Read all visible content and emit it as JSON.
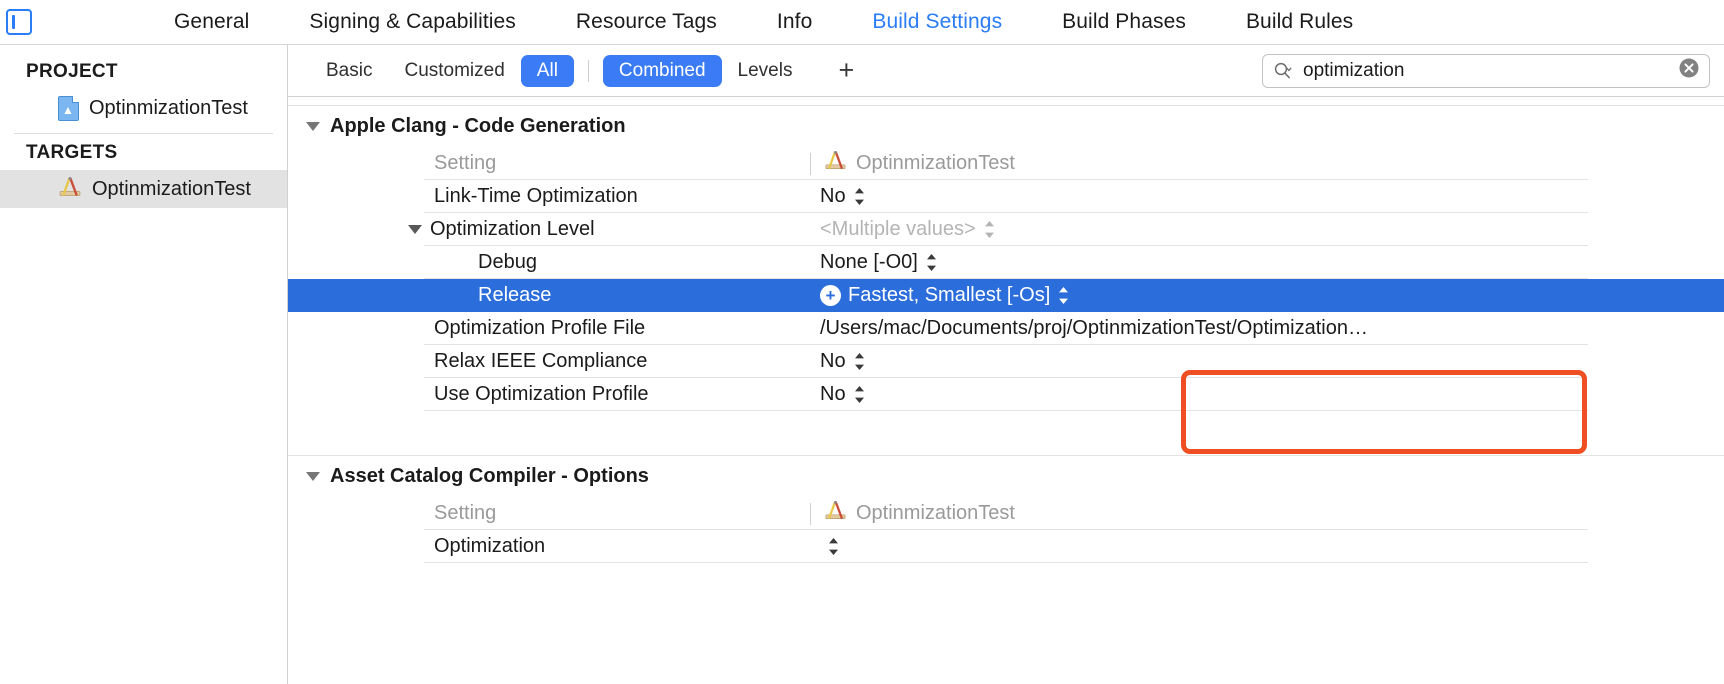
{
  "window": {
    "editor_toggle_icon": "editor-panel-icon"
  },
  "tabs": [
    {
      "label": "General",
      "active": false
    },
    {
      "label": "Signing & Capabilities",
      "active": false
    },
    {
      "label": "Resource Tags",
      "active": false
    },
    {
      "label": "Info",
      "active": false
    },
    {
      "label": "Build Settings",
      "active": true
    },
    {
      "label": "Build Phases",
      "active": false
    },
    {
      "label": "Build Rules",
      "active": false
    }
  ],
  "sidebar": {
    "project_header": "PROJECT",
    "project_items": [
      {
        "label": "OptinmizationTest",
        "icon": "project-document-icon",
        "selected": false
      }
    ],
    "targets_header": "TARGETS",
    "target_items": [
      {
        "label": "OptinmizationTest",
        "icon": "target-compass-icon",
        "selected": true
      }
    ]
  },
  "filterbar": {
    "segments": [
      {
        "label": "Basic",
        "active": false
      },
      {
        "label": "Customized",
        "active": false
      },
      {
        "label": "All",
        "active": true
      },
      {
        "label": "Combined",
        "active": true
      },
      {
        "label": "Levels",
        "active": false
      }
    ],
    "add_button_label": "+",
    "add_button_icon": "plus-icon"
  },
  "search": {
    "value": "optimization",
    "placeholder": "",
    "icon": "search-magnifier-icon",
    "dropdown_icon": "chevron-down-icon",
    "clear_icon": "clear-circle-x-icon"
  },
  "sections": [
    {
      "title": "Apple Clang - Code Generation",
      "header_row": {
        "name": "Setting",
        "value": "OptinmizationTest",
        "icon": "target-compass-icon"
      },
      "rows": [
        {
          "name": "Link-Time Optimization",
          "value": "No",
          "stepper": true,
          "indent": "normal",
          "state": "normal"
        },
        {
          "name": "Optimization Level",
          "value": "<Multiple values>",
          "stepper": true,
          "indent": "group",
          "state": "muted"
        },
        {
          "name": "Debug",
          "value": "None [-O0]",
          "stepper": true,
          "indent": "child",
          "state": "normal"
        },
        {
          "name": "Release",
          "value": "Fastest, Smallest [-Os]",
          "stepper": true,
          "indent": "child",
          "state": "selected",
          "badge": "+"
        },
        {
          "name": "Optimization Profile File",
          "value": "/Users/mac/Documents/proj/OptinmizationTest/Optimization…",
          "stepper": false,
          "indent": "normal",
          "state": "normal"
        },
        {
          "name": "Relax IEEE Compliance",
          "value": "No",
          "stepper": true,
          "indent": "normal",
          "state": "normal"
        },
        {
          "name": "Use Optimization Profile",
          "value": "No",
          "stepper": true,
          "indent": "normal",
          "state": "normal"
        }
      ]
    },
    {
      "title": "Asset Catalog Compiler - Options",
      "header_row": {
        "name": "Setting",
        "value": "OptinmizationTest",
        "icon": "target-compass-icon"
      },
      "rows": [
        {
          "name": "Optimization",
          "value": "",
          "stepper": true,
          "indent": "normal",
          "state": "normal"
        }
      ]
    }
  ],
  "annotation": {
    "shape": "rounded-rectangle-highlight",
    "color": "#f04e23"
  },
  "colors": {
    "accent_blue": "#3b7cf6",
    "selection_blue": "#2a6ddb",
    "link_blue": "#2a7cf7",
    "annotation_red": "#f04e23",
    "muted_gray": "#9a9a9a"
  }
}
